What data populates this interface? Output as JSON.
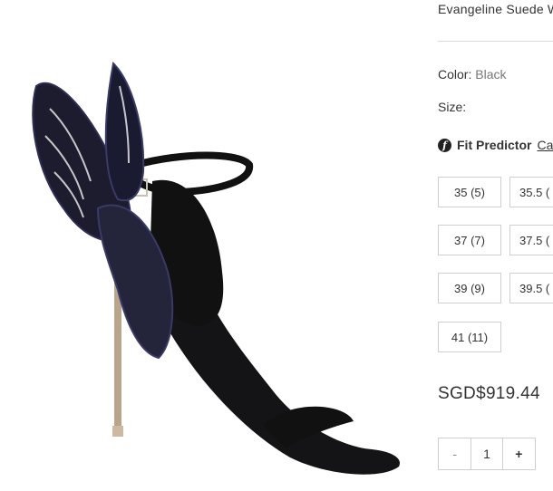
{
  "product": {
    "title": "Evangeline Suede W",
    "color_label": "Color:",
    "color_value": "Black",
    "size_label": "Size:",
    "fit_predictor_label": "Fit Predictor",
    "fit_predictor_link": "Cal",
    "sizes": [
      "35 (5)",
      "35.5 (",
      "37 (7)",
      "37.5 (",
      "39 (9)",
      "39.5 (",
      "41 (11)"
    ],
    "price": "SGD$919.44",
    "quantity": {
      "minus_label": "-",
      "value": "1",
      "plus_label": "+"
    }
  },
  "colors": {
    "text": "#333333",
    "muted": "#777777",
    "border": "#cfcfcf",
    "shoe_black": "#0d0d0f",
    "heel_metal": "#b9a48c"
  },
  "icons": {
    "fit_predictor": "fit-predictor-icon"
  }
}
